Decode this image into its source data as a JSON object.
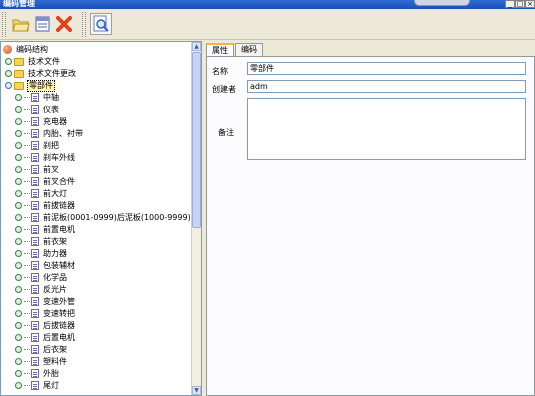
{
  "window": {
    "title": "编码管理"
  },
  "toolbar": {
    "buttons": [
      {
        "name": "open-folder",
        "icon": "folder-open-icon"
      },
      {
        "name": "edit",
        "icon": "document-edit-icon"
      },
      {
        "name": "delete",
        "icon": "red-x-icon"
      },
      {
        "name": "search",
        "icon": "magnifier-page-icon"
      }
    ]
  },
  "tree": {
    "root": "编码结构",
    "groups": [
      "技术文件",
      "技术文件更改"
    ],
    "selected_group": "零部件",
    "items": [
      "中轴",
      "仪表",
      "充电器",
      "内胎、衬带",
      "刹把",
      "刹车外线",
      "前叉",
      "前叉合件",
      "前大灯",
      "前拔链器",
      "前泥板(0001-0999)后泥板(1000-9999)",
      "前置电机",
      "前衣架",
      "助力器",
      "包装辅材",
      "化学品",
      "反光片",
      "变速外管",
      "变速转把",
      "后拔链器",
      "后置电机",
      "后衣架",
      "塑料件",
      "外胎",
      "尾灯"
    ]
  },
  "details": {
    "tabs": [
      "属性",
      "编码"
    ],
    "active_tab": "属性",
    "name_label": "名称",
    "name_value": "零部件",
    "creator_label": "创建者",
    "creator_value": "adm",
    "notes_label": "备注",
    "notes_value": ""
  },
  "colors": {
    "titlebar": "#1b4fb5",
    "selection": "#fff3b0",
    "tab_accent": "#f8b33e"
  }
}
